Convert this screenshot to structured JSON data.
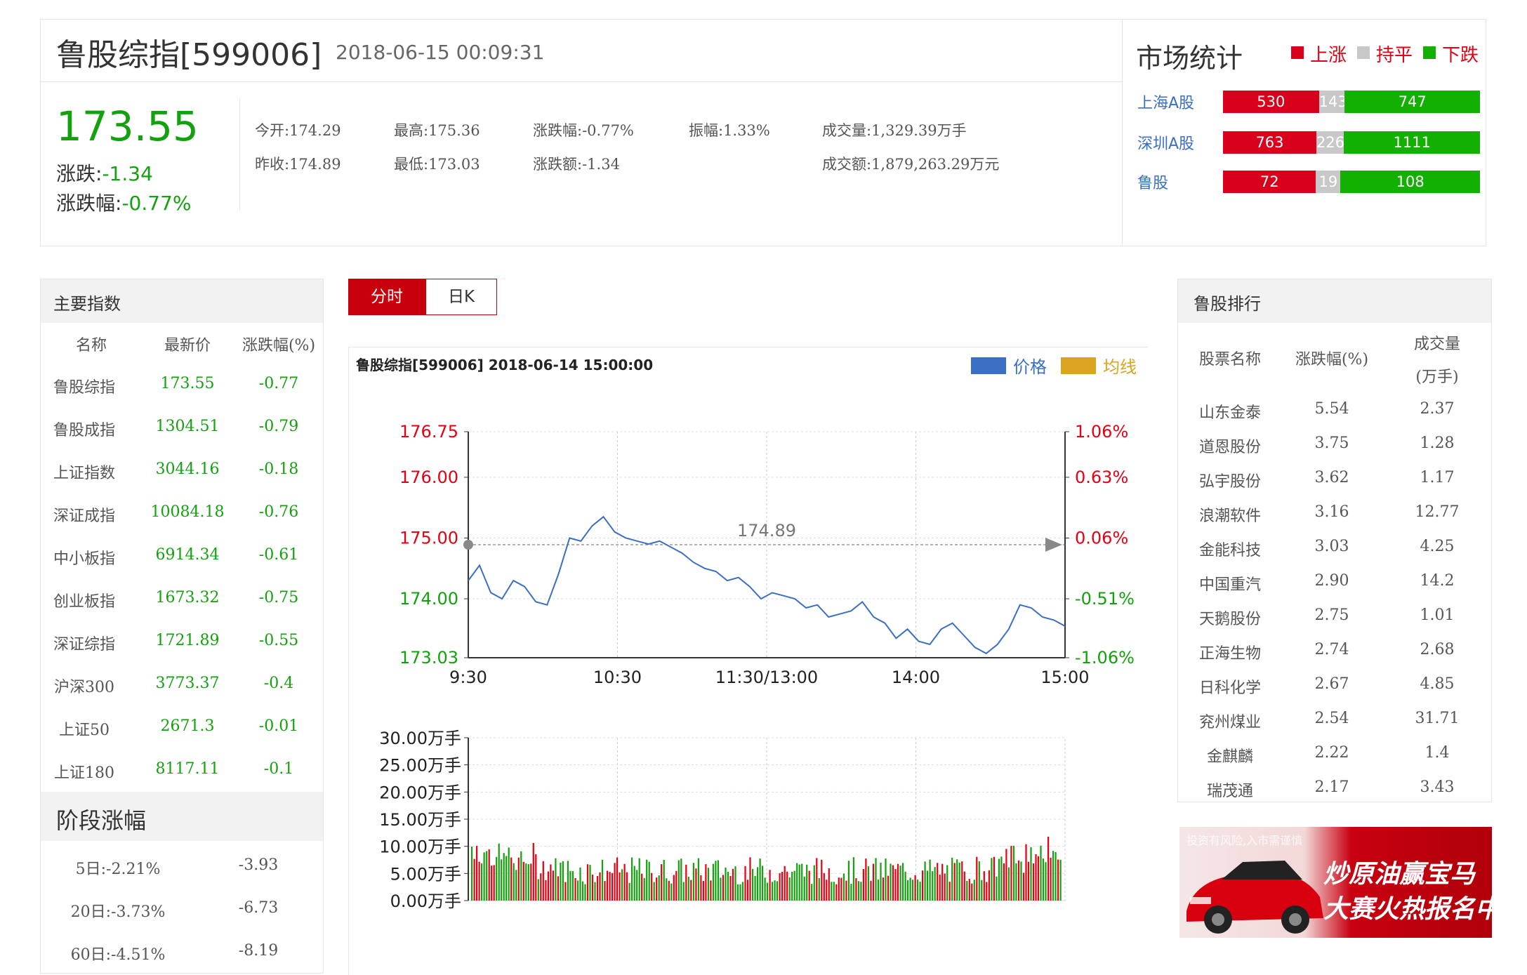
{
  "header": {
    "title": "鲁股综指[599006]",
    "datetime": "2018-06-15 00:09:31",
    "price": "173.55",
    "change_label": "涨跌:",
    "change_value": "-1.34",
    "pct_label": "涨跌幅:",
    "pct_value": "-0.77%",
    "stats": {
      "open": "今开:174.29",
      "prev_close": "昨收:174.89",
      "high": "最高:175.36",
      "low": "最低:173.03",
      "chg_pct": "涨跌幅:-0.77%",
      "chg_amt": "涨跌额:-1.34",
      "amplitude": "振幅:1.33%",
      "volume": "成交量:1,329.39万手",
      "turnover": "成交额:1,879,263.29万元"
    }
  },
  "market": {
    "title": "市场统计",
    "legend": [
      "上涨",
      "持平",
      "下跌"
    ],
    "colors": {
      "up": "#d9001b",
      "flat": "#c8c8c8",
      "down": "#12b000"
    },
    "rows": [
      {
        "name": "上海A股",
        "up": "530",
        "flat": "143",
        "down": "747"
      },
      {
        "name": "深圳A股",
        "up": "763",
        "flat": "226",
        "down": "1111"
      },
      {
        "name": "鲁股",
        "up": "72",
        "flat": "19",
        "down": "108"
      }
    ]
  },
  "main_indices": {
    "title": "主要指数",
    "headers": [
      "名称",
      "最新价",
      "涨跌幅(%)"
    ],
    "rows": [
      [
        "鲁股综指",
        "173.55",
        "-0.77"
      ],
      [
        "鲁股成指",
        "1304.51",
        "-0.79"
      ],
      [
        "上证指数",
        "3044.16",
        "-0.18"
      ],
      [
        "深证成指",
        "10084.18",
        "-0.76"
      ],
      [
        "中小板指",
        "6914.34",
        "-0.61"
      ],
      [
        "创业板指",
        "1673.32",
        "-0.75"
      ],
      [
        "深证综指",
        "1721.89",
        "-0.55"
      ],
      [
        "沪深300",
        "3773.37",
        "-0.4"
      ],
      [
        "上证50",
        "2671.3",
        "-0.01"
      ],
      [
        "上证180",
        "8117.11",
        "-0.1"
      ]
    ]
  },
  "stage": {
    "title": "阶段涨幅",
    "rows": [
      [
        "5日:-2.21%",
        "-3.93"
      ],
      [
        "20日:-3.73%",
        "-6.73"
      ],
      [
        "60日:-4.51%",
        "-8.19"
      ]
    ]
  },
  "tabs": [
    "分时",
    "日K"
  ],
  "chart_data": {
    "type": "line",
    "title": "鲁股综指[599006] 2018-06-14 15:00:00",
    "legend": [
      "价格",
      "均线"
    ],
    "colors": {
      "price": "#3a6fc4",
      "avg": "#d9a520",
      "up": "#e60012",
      "down": "#13a10e"
    },
    "prev_close": 174.89,
    "prev_close_label": "174.89",
    "y_ticks": [
      "176.75",
      "176.00",
      "175.00",
      "174.00",
      "173.03"
    ],
    "y_tick_values": [
      176.75,
      176.0,
      175.0,
      174.0,
      173.03
    ],
    "y_ticks_right": [
      "1.06%",
      "0.63%",
      "0.06%",
      "-0.51%",
      "-1.06%"
    ],
    "x_ticks": [
      "9:30",
      "10:30",
      "11:30/13:00",
      "14:00",
      "15:00"
    ],
    "ylim": [
      173.03,
      176.75
    ],
    "price_series": [
      174.3,
      174.55,
      174.1,
      174.0,
      174.3,
      174.2,
      173.95,
      173.9,
      174.4,
      175.0,
      174.95,
      175.2,
      175.35,
      175.1,
      175.0,
      174.95,
      174.9,
      174.95,
      174.85,
      174.75,
      174.6,
      174.5,
      174.45,
      174.3,
      174.35,
      174.2,
      174.0,
      174.1,
      174.05,
      174.0,
      173.85,
      173.9,
      173.7,
      173.75,
      173.8,
      173.95,
      173.7,
      173.6,
      173.35,
      173.5,
      173.3,
      173.25,
      173.5,
      173.6,
      173.4,
      173.2,
      173.1,
      173.25,
      173.5,
      173.9,
      173.85,
      173.7,
      173.65,
      173.55
    ],
    "volume": {
      "y_ticks": [
        "30.00万手",
        "25.00万手",
        "20.00万手",
        "15.00万手",
        "10.00万手",
        "5.00万手",
        "0.00万手"
      ],
      "max": 30
    }
  },
  "ranking": {
    "title": "鲁股排行",
    "headers": [
      "股票名称",
      "涨跌幅(%)",
      "成交量",
      "(万手)"
    ],
    "rows": [
      [
        "山东金泰",
        "5.54",
        "2.37"
      ],
      [
        "道恩股份",
        "3.75",
        "1.28"
      ],
      [
        "弘宇股份",
        "3.62",
        "1.17"
      ],
      [
        "浪潮软件",
        "3.16",
        "12.77"
      ],
      [
        "金能科技",
        "3.03",
        "4.25"
      ],
      [
        "中国重汽",
        "2.90",
        "14.2"
      ],
      [
        "天鹅股份",
        "2.75",
        "1.01"
      ],
      [
        "正海生物",
        "2.74",
        "2.68"
      ],
      [
        "日科化学",
        "2.67",
        "4.85"
      ],
      [
        "兖州煤业",
        "2.54",
        "31.71"
      ],
      [
        "金麒麟",
        "2.22",
        "1.4"
      ],
      [
        "瑞茂通",
        "2.17",
        "3.43"
      ]
    ]
  },
  "ad": {
    "warning": "投资有风险,入市需谨慎",
    "line1": "炒原油赢宝马",
    "line2": "大赛火热报名中"
  }
}
